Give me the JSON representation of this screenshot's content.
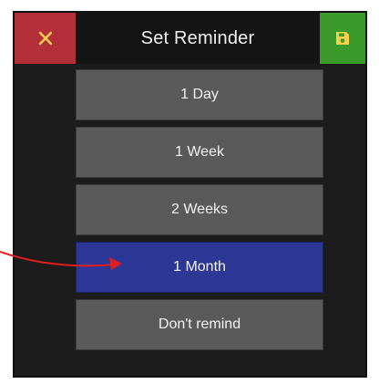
{
  "dialog": {
    "title": "Set Reminder",
    "close_icon": "close-icon",
    "save_icon": "floppy-disk-icon"
  },
  "options": [
    {
      "label": "1 Day",
      "selected": false
    },
    {
      "label": "1 Week",
      "selected": false
    },
    {
      "label": "2 Weeks",
      "selected": false
    },
    {
      "label": "1 Month",
      "selected": true
    },
    {
      "label": "Don't remind",
      "selected": false
    }
  ],
  "colors": {
    "close_button": "#b3303a",
    "save_button": "#3a9a2a",
    "option_default": "#5a5a5a",
    "option_selected": "#2c3796",
    "annotation_arrow": "#e01e1e"
  }
}
